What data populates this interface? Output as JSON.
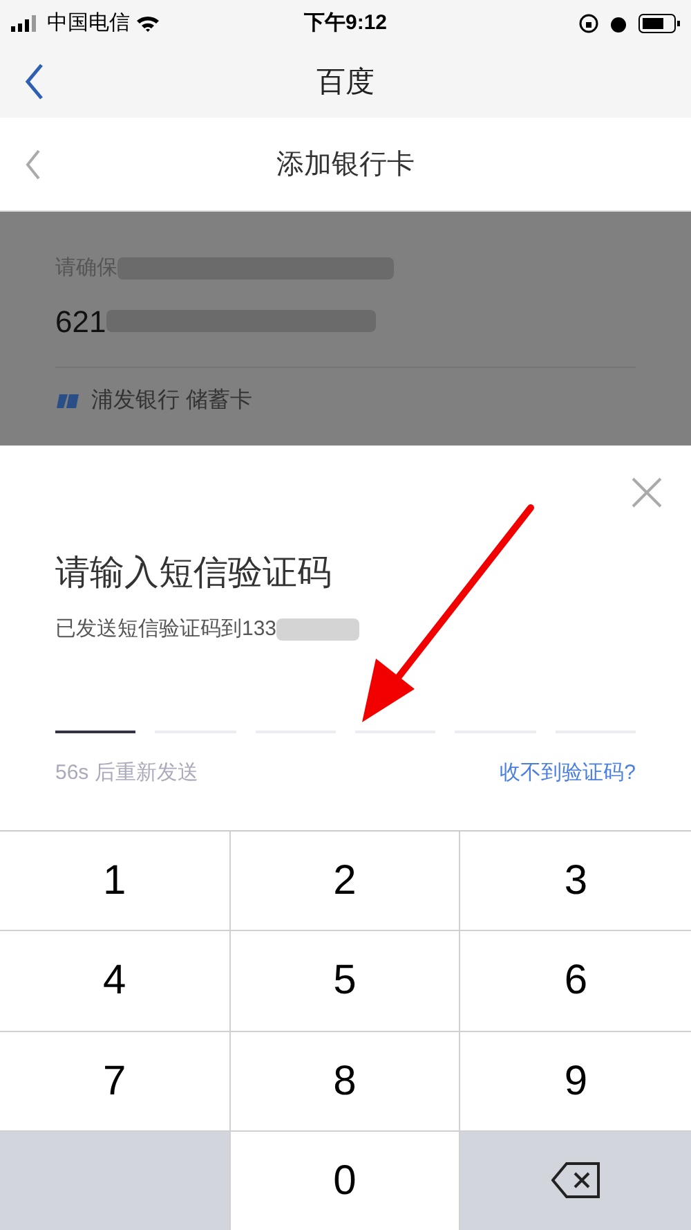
{
  "status_bar": {
    "carrier": "中国电信",
    "time": "下午9:12"
  },
  "nav_bar": {
    "title": "百度"
  },
  "page_header": {
    "title": "添加银行卡"
  },
  "card": {
    "notice": "请确保",
    "card_number": "621",
    "bank": "浦发银行 储蓄卡"
  },
  "sms_sheet": {
    "title": "请输入短信验证码",
    "sent_to": "已发送短信验证码到133",
    "code_slots": [
      {
        "selected": true
      },
      {
        "selected": false
      },
      {
        "selected": false
      },
      {
        "selected": false
      },
      {
        "selected": false
      },
      {
        "selected": false
      }
    ],
    "resend": "56s 后重新发送",
    "help_link": "收不到验证码?"
  },
  "keypad": [
    {
      "kind": "digit",
      "label": "1"
    },
    {
      "kind": "digit",
      "label": "2"
    },
    {
      "kind": "digit",
      "label": "3"
    },
    {
      "kind": "digit",
      "label": "4"
    },
    {
      "kind": "digit",
      "label": "5"
    },
    {
      "kind": "digit",
      "label": "6"
    },
    {
      "kind": "digit",
      "label": "7"
    },
    {
      "kind": "digit",
      "label": "8"
    },
    {
      "kind": "digit",
      "label": "9"
    },
    {
      "kind": "blank"
    },
    {
      "kind": "digit",
      "label": "0"
    },
    {
      "kind": "backspace"
    }
  ]
}
